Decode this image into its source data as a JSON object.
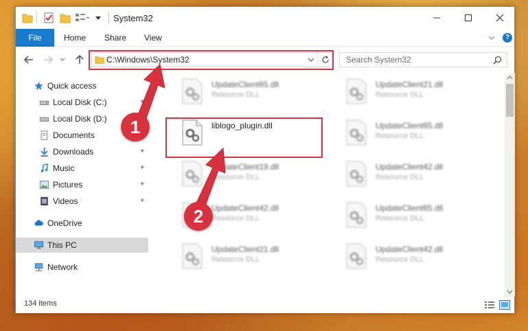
{
  "window": {
    "title": "System32"
  },
  "ribbon": {
    "tabs": [
      "File",
      "Home",
      "Share",
      "View"
    ],
    "help": "?"
  },
  "navbar": {
    "address": "C:\\Windows\\System32",
    "search_placeholder": "Search System32"
  },
  "sidebar": {
    "items": [
      {
        "label": "Quick access",
        "icon": "star-icon"
      },
      {
        "label": "Local Disk (C:)",
        "icon": "drive-icon"
      },
      {
        "label": "Local Disk (D:)",
        "icon": "drive-icon"
      },
      {
        "label": "Documents",
        "icon": "documents-icon"
      },
      {
        "label": "Downloads",
        "icon": "download-icon"
      },
      {
        "label": "Music",
        "icon": "music-icon"
      },
      {
        "label": "Pictures",
        "icon": "pictures-icon"
      },
      {
        "label": "Videos",
        "icon": "videos-icon"
      },
      {
        "label": "OneDrive",
        "icon": "cloud-icon"
      },
      {
        "label": "This PC",
        "icon": "computer-icon"
      },
      {
        "label": "Network",
        "icon": "network-icon"
      }
    ],
    "selected": "This PC"
  },
  "files": {
    "highlighted": {
      "name": "liblogo_plugin.dll"
    },
    "background": [
      {
        "name": "UpdateClient65.dll",
        "type": "Resource DLL"
      },
      {
        "name": "UpdateClient21.dll",
        "type": "Resource DLL"
      },
      {
        "name": "UpdateClient65.dll",
        "type": "Resource DLL"
      },
      {
        "name": "UpdateClient19.dll",
        "type": "Resource DLL"
      },
      {
        "name": "UpdateClient42.dll",
        "type": "Resource DLL"
      },
      {
        "name": "UpdateClient42.dll",
        "type": "Resource DLL"
      },
      {
        "name": "UpdateClient65.dll",
        "type": "Resource DLL"
      },
      {
        "name": "UpdateClient21.dll",
        "type": "Resource DLL"
      },
      {
        "name": "UpdateClient42.dll",
        "type": "Resource DLL"
      }
    ]
  },
  "status": {
    "item_count": "134 items"
  },
  "callouts": [
    "1",
    "2"
  ],
  "colors": {
    "accent": "#1979ca",
    "highlight": "#d9333f",
    "selected_bg": "#d9d9d9"
  }
}
